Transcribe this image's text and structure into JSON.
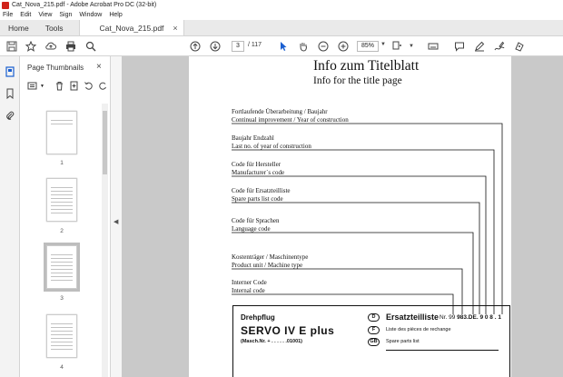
{
  "window": {
    "title": "Cat_Nova_215.pdf - Adobe Acrobat Pro DC (32-bit)"
  },
  "menu": [
    "File",
    "Edit",
    "View",
    "Sign",
    "Window",
    "Help"
  ],
  "tabs": {
    "home": "Home",
    "tools": "Tools",
    "document": "Cat_Nova_215.pdf",
    "close": "×"
  },
  "toolbar": {
    "page_current": "3",
    "page_total": "/ 117",
    "zoom": "85%"
  },
  "panel": {
    "title": "Page Thumbnails",
    "close": "×",
    "thumbnails": [
      "1",
      "2",
      "3",
      "4"
    ],
    "selected_page": "3"
  },
  "document": {
    "title": "Info  zum  Titelblatt",
    "subtitle": "Info for the title page",
    "labels": [
      {
        "de": "Fortlaufende Überarbeitung / Baujahr",
        "en": "Continual improvement / Year of construction"
      },
      {
        "de": "Baujahr Endzahl",
        "en": "Last no. of year of construction"
      },
      {
        "de": "Code für Hersteller",
        "en": "Manufacturer´s  code"
      },
      {
        "de": "Code für Ersatzteilliste",
        "en": "Spare parts list code"
      },
      {
        "de": "Code für Sprachen",
        "en": "Language code"
      },
      {
        "de": "Kostenträger / Maschinentype",
        "en": "Product unit / Machine type"
      },
      {
        "de": "Interner Code",
        "en": "Internal code"
      }
    ],
    "plate": {
      "category": "Drehpflug",
      "model": "SERVO IV E plus",
      "machine_no": "(Masch.Nr. + . . . . . .01001)",
      "badge_d": "D",
      "badge_f": "F",
      "badge_gb": "GB",
      "title_de": "Ersatzteilliste",
      "nr_prefix": "Nr. 99",
      "nr_value": "983.DE. 9 0 8 . 1",
      "title_fr": "Liste des pièces de rechange",
      "title_en": "Spare parts list"
    }
  }
}
